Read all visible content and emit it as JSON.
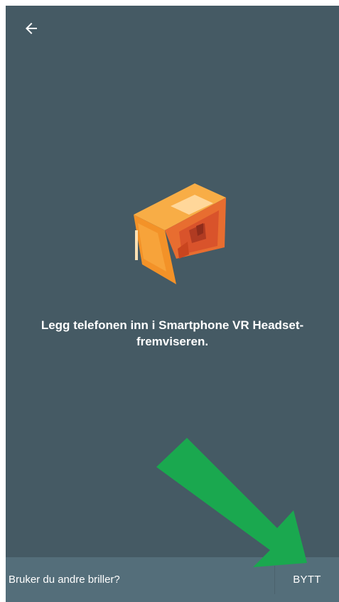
{
  "header": {
    "back_icon": "arrow-left-icon"
  },
  "main": {
    "illustration": "vr-headset-icon",
    "instruction": "Legg telefonen inn i Smartphone VR Headset-fremviseren."
  },
  "bottom_bar": {
    "question": "Bruker du andre briller?",
    "switch_label": "BYTT"
  },
  "colors": {
    "background": "#455a64",
    "bottom_bar": "#546e7a",
    "headset_orange": "#f39228",
    "headset_dark_orange": "#d9532b",
    "annotation_arrow": "#1aa84f"
  }
}
